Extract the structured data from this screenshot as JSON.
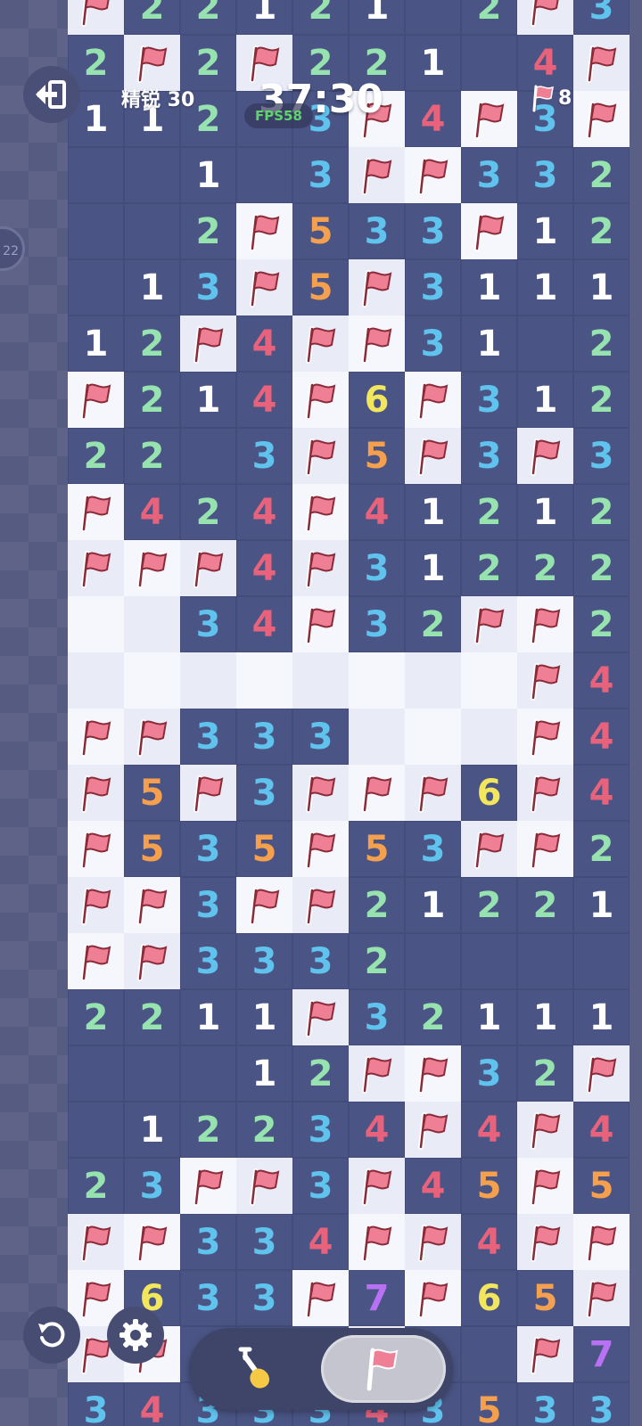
{
  "hud": {
    "level_label": "精锐 30",
    "timer": "37:30",
    "fps": "FPS58",
    "flag_count": "8",
    "side_chip": "22"
  },
  "controls": {
    "exit": "exit-icon",
    "restart": "restart-icon",
    "settings": "gear-icon",
    "dig_mode": "shovel-icon",
    "flag_mode": "flag-icon",
    "active_mode": "flag"
  },
  "board": {
    "columns": 10,
    "legend": "F = flag, H = hidden (light), . = revealed empty, digits = revealed number",
    "rows": [
      "F22121.2F3",
      "2F2F221.4F3",
      "112.3F4F3F3",
      "..1.3FF3322",
      "..2F533F12",
      ".13F5F3111",
      "12F4FF31.2",
      "F214F6F312",
      "22.3F5F3F3",
      "F424F41212",
      "FFF4F31222",
      "HH34F32FF2",
      "HHHHHHHHF4",
      "FF333HHHF4",
      "F5F3FFF6F4",
      "F535F53FF2",
      "FF3FF21221",
      "FF3332....",
      "2211F32111",
      "...12FF32F",
      ".12234F4F4",
      "23FF3F45F5",
      "FF334FF4FF",
      "F633F7F65F",
      "FF...F..F7",
      "3433343533"
    ]
  },
  "colors": {
    "revealed": "#4b5585",
    "hidden": "#e9ebf7",
    "n1": "#ffffff",
    "n2": "#97e3b0",
    "n3": "#5fc3ee",
    "n4": "#e8627c",
    "n5": "#f5a04e",
    "n6": "#f2e65c",
    "n7": "#b771f2",
    "flag": "#ef7f95"
  }
}
